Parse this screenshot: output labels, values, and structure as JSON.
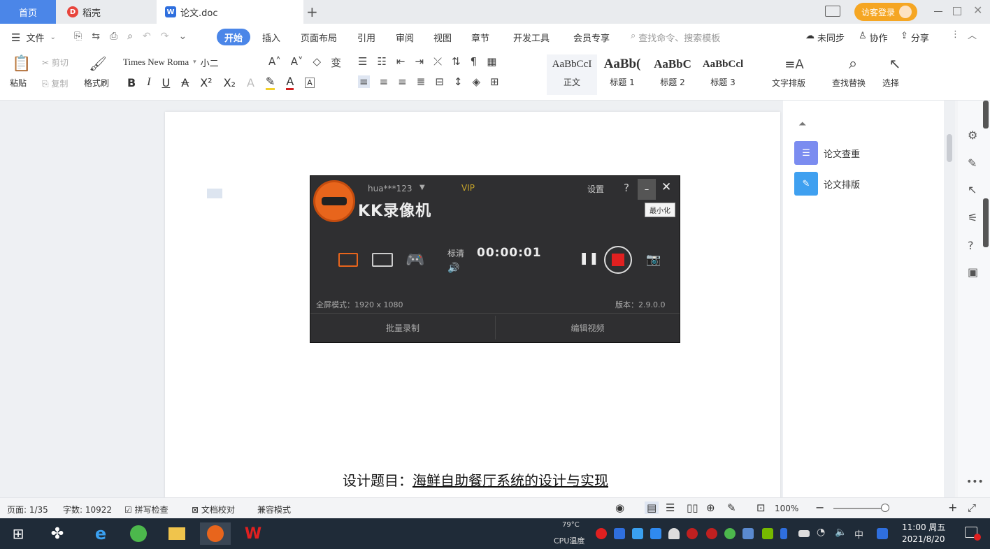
{
  "tabs": {
    "home": "首页",
    "daoke": "稻壳",
    "doc": "论文.doc",
    "new_tab": "+"
  },
  "titlebar": {
    "login": "访客登录"
  },
  "menu": {
    "file": "文件",
    "items": [
      "开始",
      "插入",
      "页面布局",
      "引用",
      "审阅",
      "视图",
      "章节",
      "开发工具",
      "会员专享"
    ],
    "search": "查找命令、搜索模板",
    "sync": "未同步",
    "collab": "协作",
    "share": "分享"
  },
  "toolbar": {
    "paste": "粘贴",
    "cut": "剪切",
    "copy": "复制",
    "format_painter": "格式刷",
    "font_name": "Times New Roma",
    "font_size": "小二",
    "styles": [
      {
        "sample": "AaBbCcI",
        "name": "正文"
      },
      {
        "sample": "AaBb(",
        "name": "标题 1"
      },
      {
        "sample": "AaBbC",
        "name": "标题 2"
      },
      {
        "sample": "AaBbCcl",
        "name": "标题 3"
      }
    ],
    "text_layout": "文字排版",
    "find_replace": "查找替换",
    "select": "选择"
  },
  "right_pane": {
    "items": [
      "论文查重",
      "论文排版"
    ]
  },
  "document": {
    "title_label": "设计题目：",
    "title_text": "海鲜自助餐厅系统的设计与实现"
  },
  "kk": {
    "user": "hua***123",
    "vip": "VIP",
    "settings": "设置",
    "help": "?",
    "tooltip": "最小化",
    "app_name": "KK录像机",
    "quality": "标清",
    "timer": "00:00:01",
    "mode": "全屏模式：1920 x 1080",
    "version": "版本：2.9.0.0",
    "batch_record": "批量录制",
    "edit_video": "编辑视频"
  },
  "status": {
    "page": "页面: 1/35",
    "words": "字数: 10922",
    "spell": "拼写检查",
    "proof": "文档校对",
    "compat": "兼容模式",
    "zoom": "100%"
  },
  "taskbar": {
    "temp": "79°C",
    "cpu": "CPU温度",
    "ime": "中",
    "time": "11:00 周五",
    "date": "2021/8/20"
  },
  "colors": {
    "accent": "#4b86e8",
    "record_red": "#e02020",
    "kk_orange": "#e8651c"
  }
}
